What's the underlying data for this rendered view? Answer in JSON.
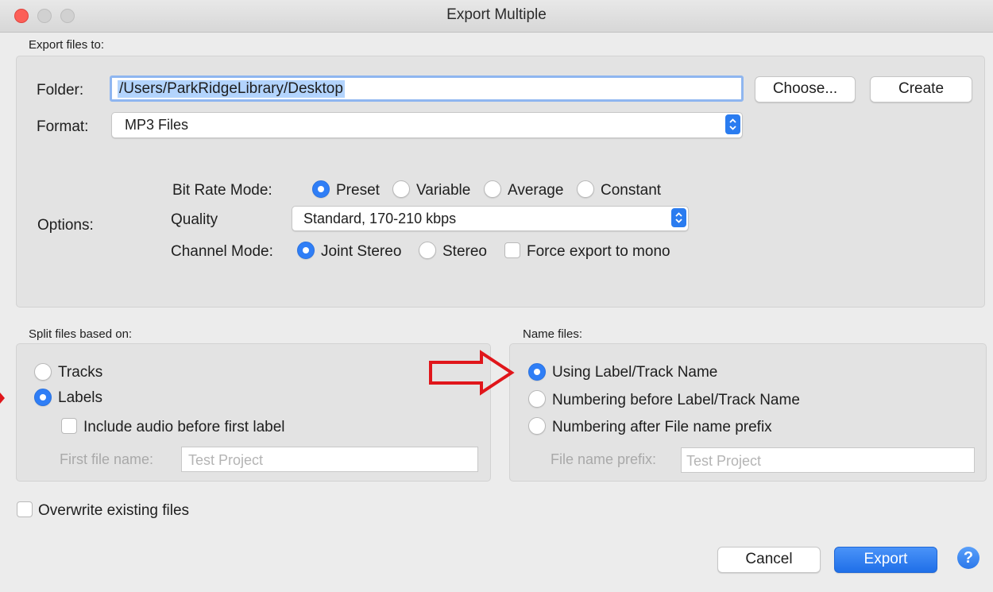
{
  "window": {
    "title": "Export Multiple"
  },
  "export_to": {
    "section_label": "Export files to:",
    "folder_label": "Folder:",
    "folder_value": "/Users/ParkRidgeLibrary/Desktop",
    "choose_label": "Choose...",
    "create_label": "Create",
    "format_label": "Format:",
    "format_value": "MP3 Files"
  },
  "options": {
    "label": "Options:",
    "bitrate_label": "Bit Rate Mode:",
    "bitrate_modes": [
      "Preset",
      "Variable",
      "Average",
      "Constant"
    ],
    "bitrate_selected": "Preset",
    "quality_label": "Quality",
    "quality_value": "Standard, 170-210 kbps",
    "channel_label": "Channel Mode:",
    "channel_modes": [
      "Joint Stereo",
      "Stereo"
    ],
    "channel_selected": "Joint Stereo",
    "force_mono_label": "Force export to mono",
    "force_mono_checked": false
  },
  "split": {
    "section_label": "Split files based on:",
    "tracks_label": "Tracks",
    "labels_label": "Labels",
    "selected": "Labels",
    "include_audio_label": "Include audio before first label",
    "include_audio_checked": false,
    "first_file_label": "First file name:",
    "first_file_placeholder": "Test Project"
  },
  "name_files": {
    "section_label": "Name files:",
    "using_label": "Using Label/Track Name",
    "numbering_before_label": "Numbering before Label/Track Name",
    "numbering_after_label": "Numbering after File name prefix",
    "selected": "Using Label/Track Name",
    "prefix_label": "File name prefix:",
    "prefix_placeholder": "Test Project"
  },
  "overwrite": {
    "label": "Overwrite existing files",
    "checked": false
  },
  "footer": {
    "cancel_label": "Cancel",
    "export_label": "Export",
    "help_label": "?"
  },
  "annotation": {
    "arrow_color": "#e0161b"
  },
  "colors": {
    "accent": "#2f7ef6",
    "close_light": "#fc5f57",
    "inactive_light": "#d1d1d1"
  }
}
